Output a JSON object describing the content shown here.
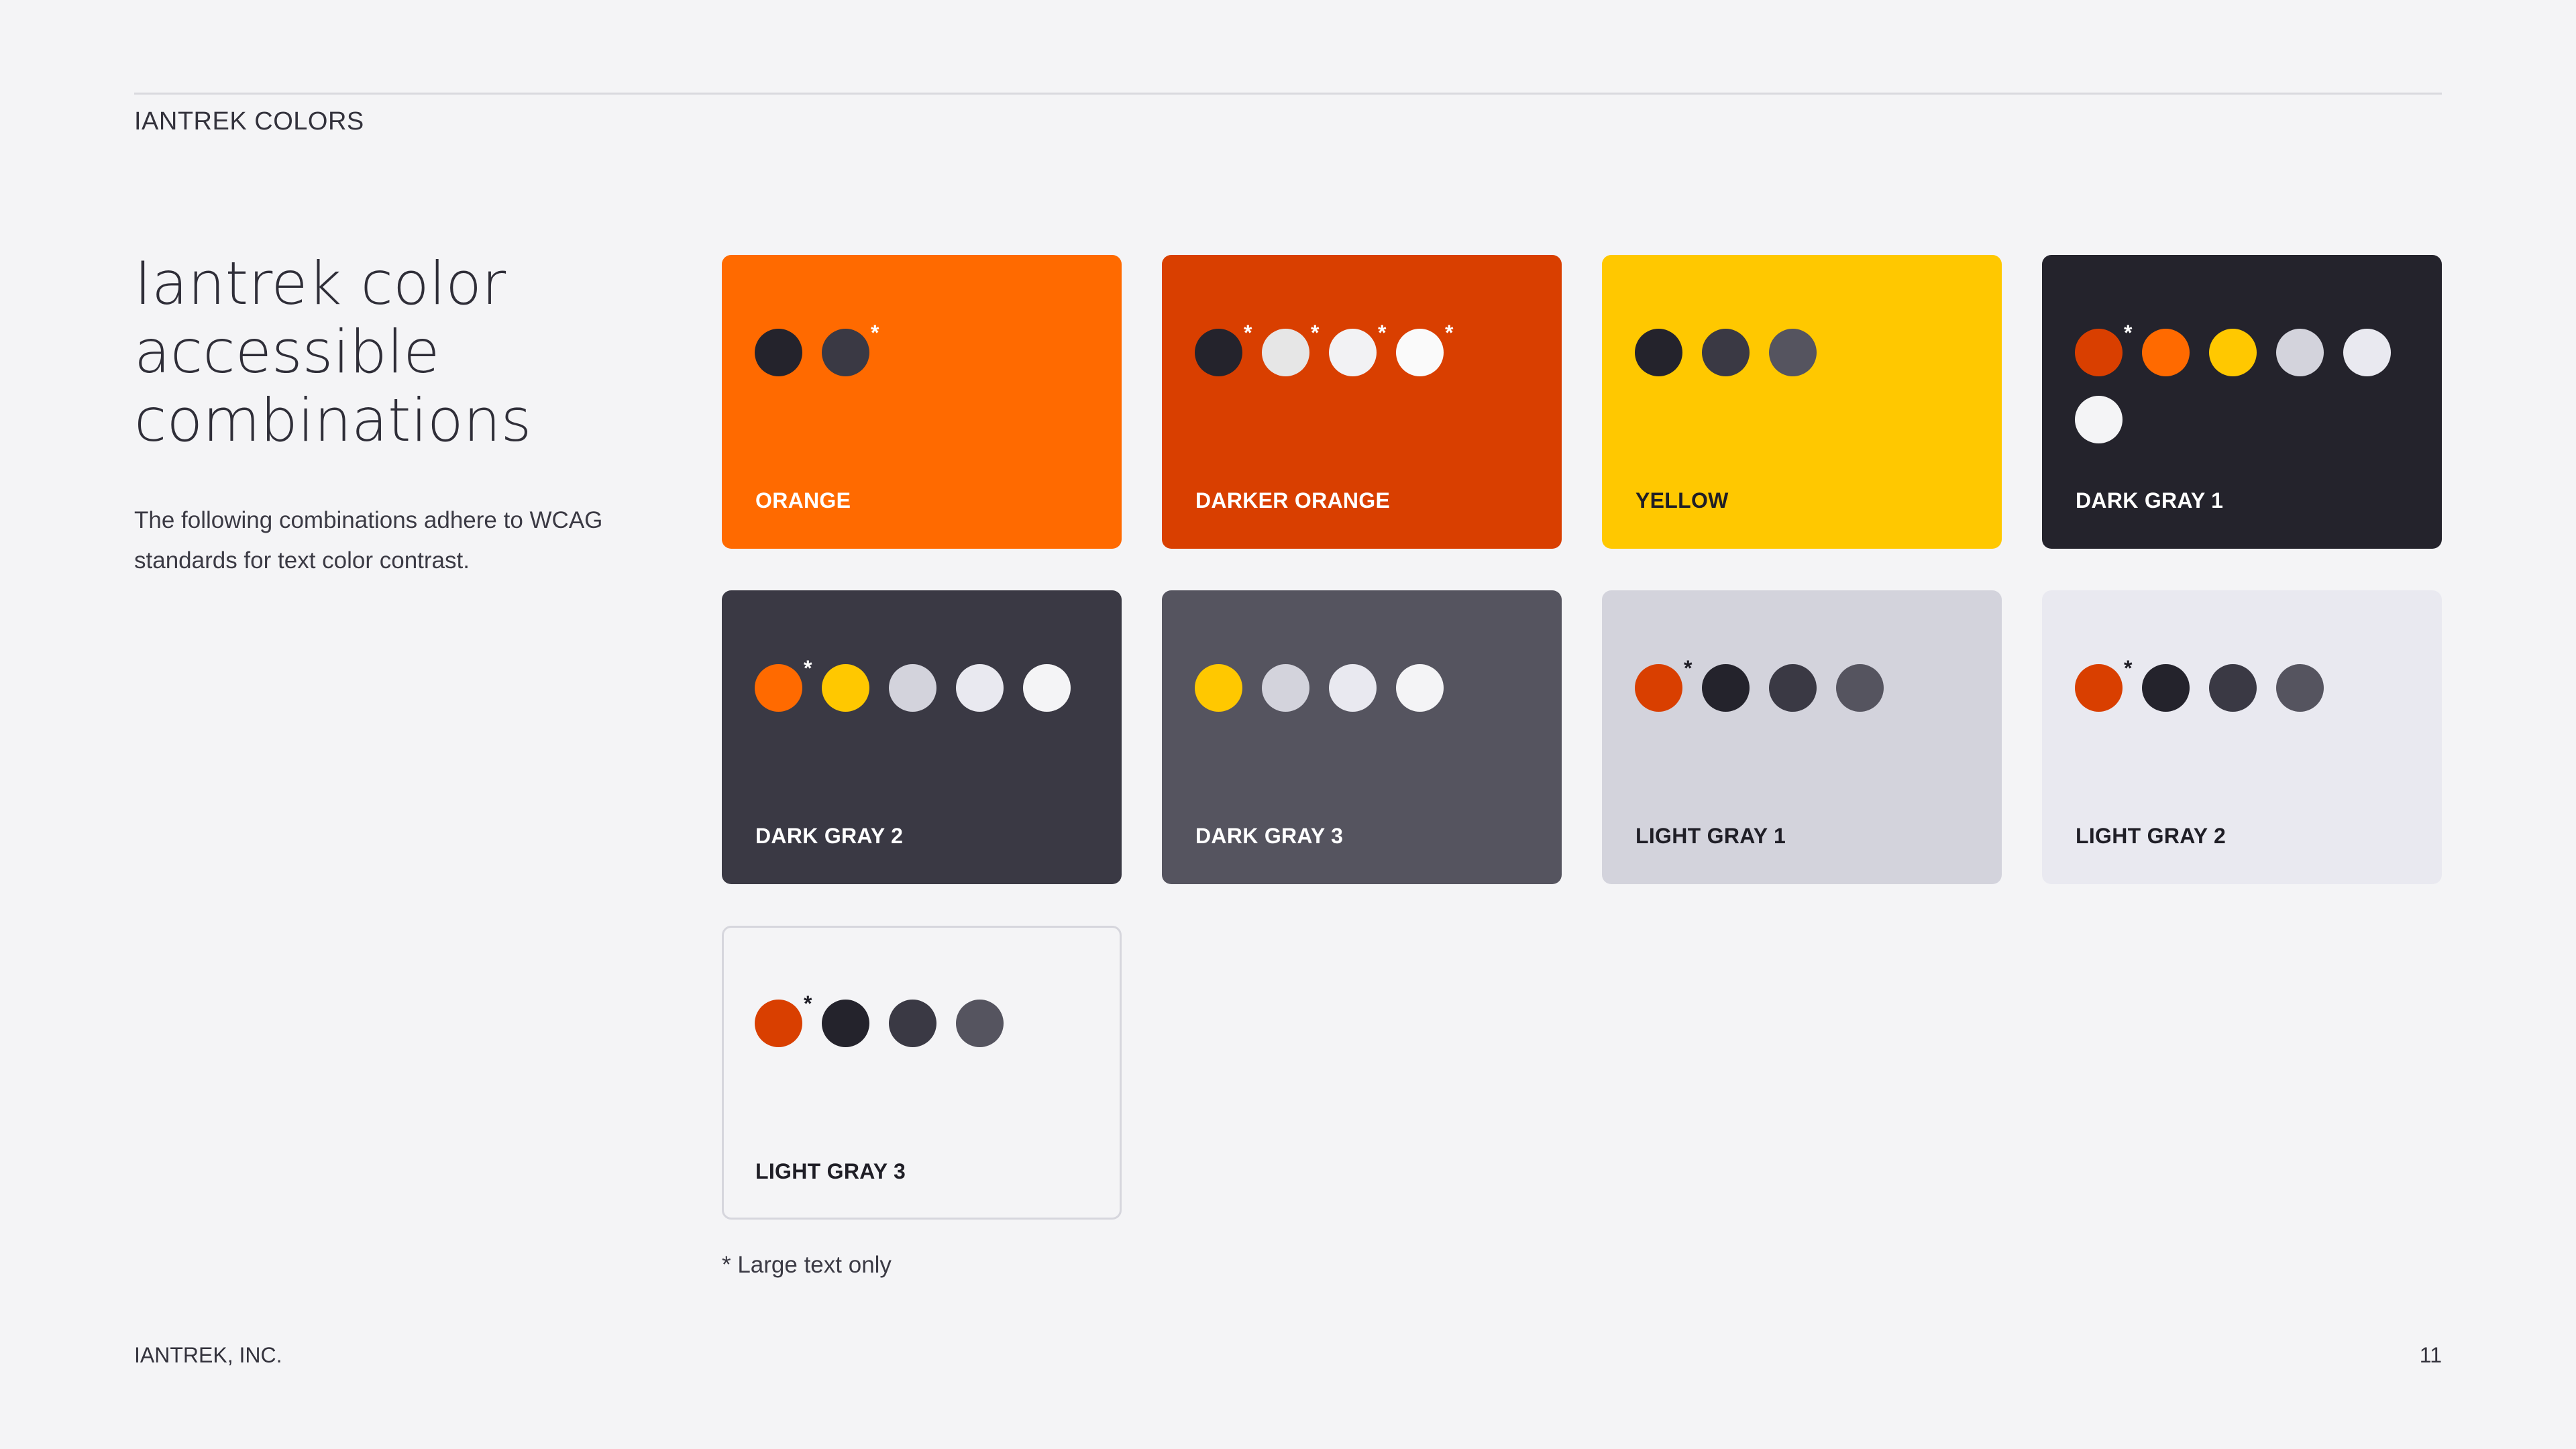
{
  "header": {
    "label": "IANTREK COLORS"
  },
  "intro": {
    "title": "Iantrek color accessible combinations",
    "description": "The following combinations adhere to WCAG standards for text color contrast."
  },
  "cards": [
    {
      "label": "ORANGE",
      "bg": "#ff6a00",
      "text_color": "#ffffff",
      "star_color": "#ffffff",
      "dots": [
        {
          "color": "#24232c",
          "large_text_only": false
        },
        {
          "color": "#3a3944",
          "large_text_only": true
        }
      ]
    },
    {
      "label": "DARKER ORANGE",
      "bg": "#d93f00",
      "text_color": "#ffffff",
      "star_color": "#ffffff",
      "dots": [
        {
          "color": "#24232c",
          "large_text_only": true
        },
        {
          "color": "#e6e6e6",
          "large_text_only": true
        },
        {
          "color": "#f2f2f4",
          "large_text_only": true
        },
        {
          "color": "#fafafa",
          "large_text_only": true
        }
      ]
    },
    {
      "label": "YELLOW",
      "bg": "#ffc800",
      "text_color": "#1f1e26",
      "star_color": "#1f1e26",
      "dots": [
        {
          "color": "#24232c",
          "large_text_only": false
        },
        {
          "color": "#3a3944",
          "large_text_only": false
        },
        {
          "color": "#55545f",
          "large_text_only": false
        }
      ]
    },
    {
      "label": "DARK GRAY 1",
      "bg": "#24232c",
      "text_color": "#ffffff",
      "star_color": "#ffffff",
      "dots": [
        {
          "color": "#d93f00",
          "large_text_only": true
        },
        {
          "color": "#ff6a00",
          "large_text_only": false
        },
        {
          "color": "#ffc800",
          "large_text_only": false
        },
        {
          "color": "#d3d3dc",
          "large_text_only": false
        },
        {
          "color": "#e9e9f0",
          "large_text_only": false
        },
        {
          "color": "#f4f4f6",
          "large_text_only": false
        }
      ]
    },
    {
      "label": "DARK GRAY 2",
      "bg": "#3a3944",
      "text_color": "#ffffff",
      "star_color": "#ffffff",
      "dots": [
        {
          "color": "#ff6a00",
          "large_text_only": true
        },
        {
          "color": "#ffc800",
          "large_text_only": false
        },
        {
          "color": "#d3d3dc",
          "large_text_only": false
        },
        {
          "color": "#e9e9f0",
          "large_text_only": false
        },
        {
          "color": "#f4f4f6",
          "large_text_only": false
        }
      ]
    },
    {
      "label": "DARK GRAY 3",
      "bg": "#55545f",
      "text_color": "#ffffff",
      "star_color": "#ffffff",
      "dots": [
        {
          "color": "#ffc800",
          "large_text_only": false
        },
        {
          "color": "#d3d3dc",
          "large_text_only": false
        },
        {
          "color": "#e9e9f0",
          "large_text_only": false
        },
        {
          "color": "#f4f4f6",
          "large_text_only": false
        }
      ]
    },
    {
      "label": "LIGHT GRAY 1",
      "bg": "#d3d3dc",
      "text_color": "#1f1e26",
      "star_color": "#1f1e26",
      "dots": [
        {
          "color": "#d93f00",
          "large_text_only": true
        },
        {
          "color": "#24232c",
          "large_text_only": false
        },
        {
          "color": "#3a3944",
          "large_text_only": false
        },
        {
          "color": "#55545f",
          "large_text_only": false
        }
      ]
    },
    {
      "label": "LIGHT GRAY 2",
      "bg": "#e9e9f0",
      "text_color": "#1f1e26",
      "star_color": "#1f1e26",
      "dots": [
        {
          "color": "#d93f00",
          "large_text_only": true
        },
        {
          "color": "#24232c",
          "large_text_only": false
        },
        {
          "color": "#3a3944",
          "large_text_only": false
        },
        {
          "color": "#55545f",
          "large_text_only": false
        }
      ]
    },
    {
      "label": "LIGHT GRAY 3",
      "bg": "#f4f4f6",
      "border": "#d6d6dd",
      "text_color": "#1f1e26",
      "star_color": "#1f1e26",
      "dots": [
        {
          "color": "#d93f00",
          "large_text_only": true
        },
        {
          "color": "#24232c",
          "large_text_only": false
        },
        {
          "color": "#3a3944",
          "large_text_only": false
        },
        {
          "color": "#55545f",
          "large_text_only": false
        }
      ]
    }
  ],
  "star_symbol": "*",
  "footnote": "* Large text only",
  "footer": {
    "company": "IANTREK, INC.",
    "page_number": "11"
  }
}
